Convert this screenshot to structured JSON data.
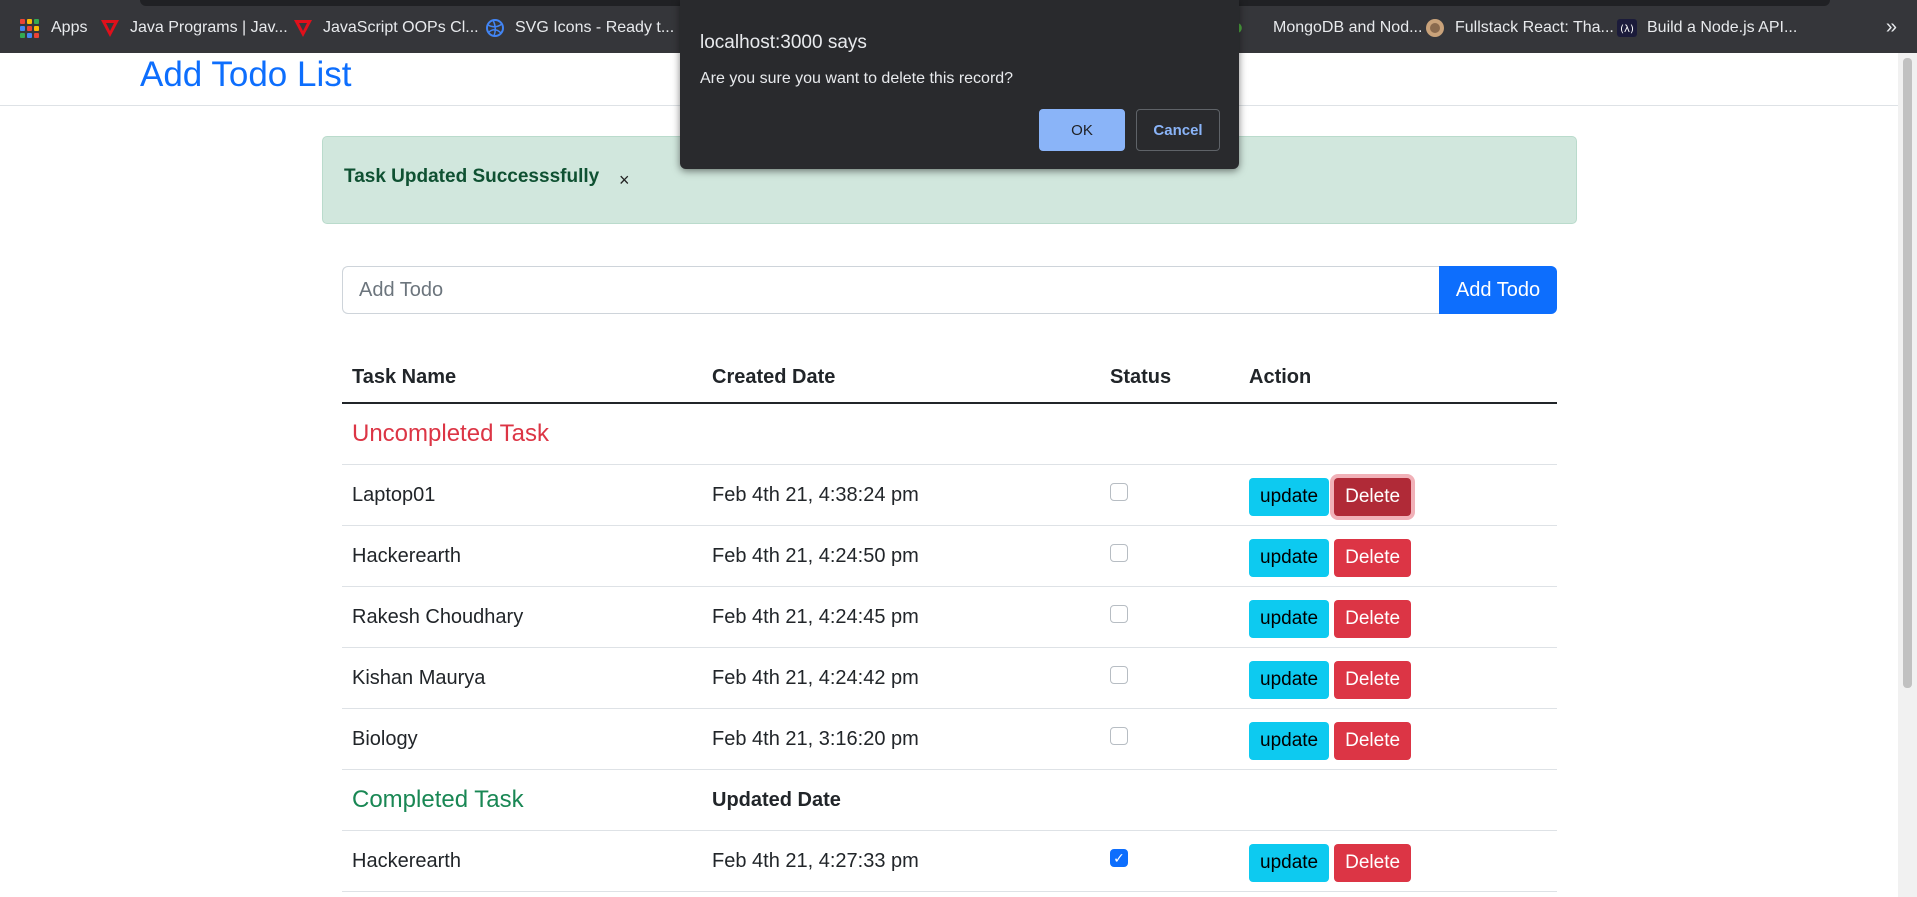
{
  "bookmarks": {
    "apps_label": "Apps",
    "items": [
      {
        "label": "Java Programs | Jav...",
        "icon": "java-programs-icon"
      },
      {
        "label": "JavaScript OOPs Cl...",
        "icon": "javascript-oops-icon"
      },
      {
        "label": "SVG Icons - Ready t...",
        "icon": "svg-icons-icon"
      },
      {
        "label": "MongoDB and Nod...",
        "icon": "mongodb-leaf-icon"
      },
      {
        "label": "Fullstack React: Tha...",
        "icon": "fullstack-react-icon"
      },
      {
        "label": "Build a Node.js API...",
        "icon": "lambda-icon"
      }
    ],
    "more": "»"
  },
  "navbar": {
    "brand": "Add Todo List"
  },
  "alert": {
    "message": "Task Updated Successsfully",
    "close": "×"
  },
  "form": {
    "placeholder": "Add Todo",
    "button": "Add Todo"
  },
  "table": {
    "headers": {
      "task": "Task Name",
      "created": "Created Date",
      "status": "Status",
      "action": "Action"
    },
    "uncompleted_title": "Uncompleted Task",
    "completed_title": "Completed Task",
    "updated_header": "Updated Date",
    "update_label": "update",
    "delete_label": "Delete",
    "uncompleted": [
      {
        "name": "Laptop01",
        "date": "Feb 4th 21, 4:38:24 pm"
      },
      {
        "name": "Hackerearth",
        "date": "Feb 4th 21, 4:24:50 pm"
      },
      {
        "name": "Rakesh Choudhary",
        "date": "Feb 4th 21, 4:24:45 pm"
      },
      {
        "name": "Kishan Maurya",
        "date": "Feb 4th 21, 4:24:42 pm"
      },
      {
        "name": "Biology",
        "date": "Feb 4th 21, 3:16:20 pm"
      }
    ],
    "completed": [
      {
        "name": "Hackerearth",
        "date": "Feb 4th 21, 4:27:33 pm",
        "checked_mark": "✓"
      }
    ]
  },
  "dialog": {
    "title": "localhost:3000 says",
    "message": "Are you sure you want to delete this record?",
    "ok": "OK",
    "cancel": "Cancel"
  },
  "colors": {
    "primary": "#0d6efd",
    "danger": "#dc3545",
    "success": "#198754",
    "info": "#0dcaf0",
    "alert_bg": "#d1e7dd"
  }
}
